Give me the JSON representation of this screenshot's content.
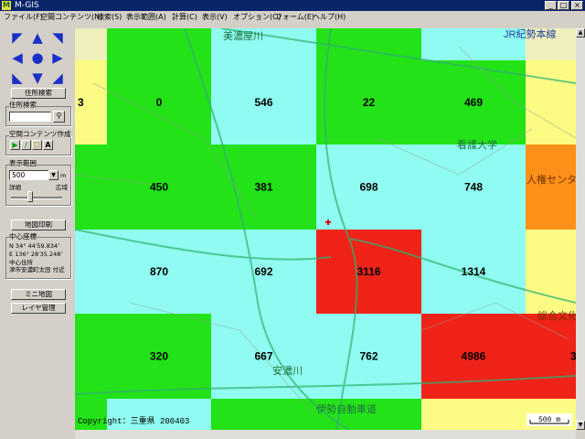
{
  "window": {
    "title": "M-GIS",
    "icon_letter": "M"
  },
  "menu": [
    "ファイル(F)",
    "空間コンテンツ(N)",
    "検索(S)",
    "表示範囲(A)",
    "計算(C)",
    "表示(V)",
    "オプション(O)",
    "フォーム(E)",
    "ヘルプ(H)"
  ],
  "panel": {
    "address_search_button": "住所検索",
    "address_search_group": "住所検索",
    "address_input_value": "",
    "spatial_group": "空間コンテンツ作成",
    "range_group": "表示範囲",
    "range_value": "500",
    "range_unit": "m",
    "detail_label": "詳細",
    "wide_label": "広域",
    "slider_level": 0.35,
    "print_button": "地図印刷",
    "center_group": "中心座標",
    "lat_text": "N  34° 44′59.834″",
    "lon_text": "E 136° 28′35.248″",
    "center_addr_label": "中心住所",
    "center_addr_value": "津市安濃町太田 付近",
    "mini_map_button": "ミニ地図",
    "layer_button": "レイヤ管理"
  },
  "map": {
    "place_labels": [
      "美濃屋川",
      "JR紀勢本線",
      "看護大学",
      "人権センタ",
      "総合文化",
      "安濃川",
      "伊勢自動車道"
    ],
    "copyright": "Copyright：三重県 200403",
    "scale_label": "500 m",
    "colors": {
      "green": "#00e000",
      "cyan": "#80ffff",
      "red": "#f00000",
      "orange": "#ff8000",
      "yellow": "#ffff80"
    },
    "grid_rows": [
      {
        "cells": [
          {
            "value": "3",
            "color": "yellow"
          },
          {
            "value": "0",
            "color": "green"
          },
          {
            "value": "546",
            "color": "cyan"
          },
          {
            "value": "22",
            "color": "green"
          },
          {
            "value": "469",
            "color": "green"
          },
          {
            "value": "",
            "color": "yellow"
          }
        ]
      },
      {
        "cells": [
          {
            "value": "",
            "color": "green"
          },
          {
            "value": "450",
            "color": "green"
          },
          {
            "value": "381",
            "color": "green"
          },
          {
            "value": "698",
            "color": "cyan"
          },
          {
            "value": "748",
            "color": "cyan"
          },
          {
            "value": "",
            "color": "orange"
          }
        ]
      },
      {
        "cells": [
          {
            "value": "",
            "color": "cyan"
          },
          {
            "value": "870",
            "color": "cyan"
          },
          {
            "value": "692",
            "color": "cyan"
          },
          {
            "value": "3116",
            "color": "red"
          },
          {
            "value": "1314",
            "color": "cyan"
          },
          {
            "value": "",
            "color": "yellow"
          }
        ]
      },
      {
        "cells": [
          {
            "value": "",
            "color": "green"
          },
          {
            "value": "320",
            "color": "green"
          },
          {
            "value": "667",
            "color": "cyan"
          },
          {
            "value": "762",
            "color": "cyan"
          },
          {
            "value": "4986",
            "color": "red"
          },
          {
            "value": "3",
            "color": "red"
          }
        ]
      },
      {
        "cells": [
          {
            "value": "",
            "color": "green"
          },
          {
            "value": "",
            "color": "cyan"
          },
          {
            "value": "",
            "color": "green"
          },
          {
            "value": "",
            "color": "green"
          },
          {
            "value": "",
            "color": "yellow"
          },
          {
            "value": "",
            "color": "yellow"
          }
        ]
      }
    ]
  }
}
